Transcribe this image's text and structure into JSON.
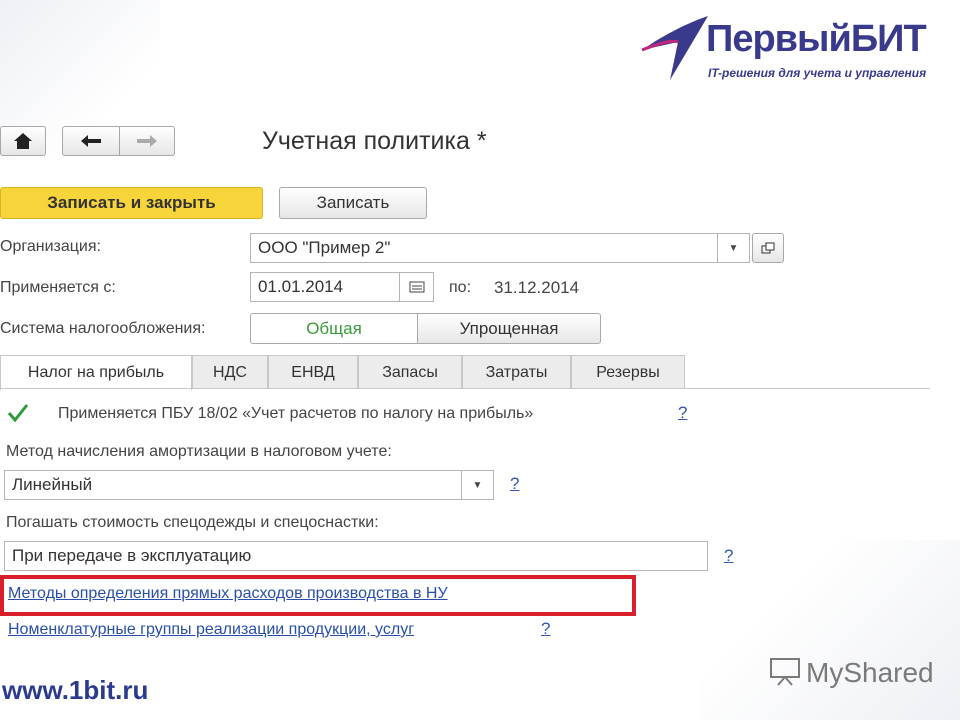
{
  "logo": {
    "title": "ПервыйБИТ",
    "subtitle": "IT-решения для учета и управления"
  },
  "nav": {
    "home_icon": "home-icon",
    "back_icon": "arrow-left-icon",
    "forward_icon": "arrow-right-icon"
  },
  "page_title": "Учетная политика *",
  "toolbar": {
    "save_close_label": "Записать и закрыть",
    "save_label": "Записать"
  },
  "organization": {
    "label": "Организация:",
    "value": "ООО \"Пример 2\""
  },
  "applies_from": {
    "label": "Применяется с:",
    "value": "01.01.2014",
    "to_label": "по:",
    "to_value": "31.12.2014"
  },
  "tax_system": {
    "label": "Система налогообложения:",
    "options": [
      "Общая",
      "Упрощенная"
    ],
    "selected": "Общая"
  },
  "tabs": [
    "Налог на прибыль",
    "НДС",
    "ЕНВД",
    "Запасы",
    "Затраты",
    "Резервы"
  ],
  "pbu": {
    "label": "Применяется ПБУ 18/02 «Учет расчетов по налогу на прибыль»",
    "checked": true
  },
  "amort": {
    "label": "Метод начисления амортизации в налоговом учете:",
    "value": "Линейный"
  },
  "workwear": {
    "label": "Погашать стоимость спецодежды и спецоснастки:",
    "value": "При передаче в эксплуатацию"
  },
  "links": {
    "direct_costs": "Методы определения прямых расходов производства в НУ",
    "nomenclature": "Номенклатурные группы реализации продукции, услуг"
  },
  "help": "?",
  "footer": {
    "website": "www.1bit.ru",
    "watermark": "MyShared"
  },
  "colors": {
    "accent_yellow": "#f7d43a",
    "highlight_red": "#d9202a",
    "link_blue": "#2a4fa8",
    "brand_blue": "#3a3a8c",
    "check_green": "#2e9a3a"
  }
}
